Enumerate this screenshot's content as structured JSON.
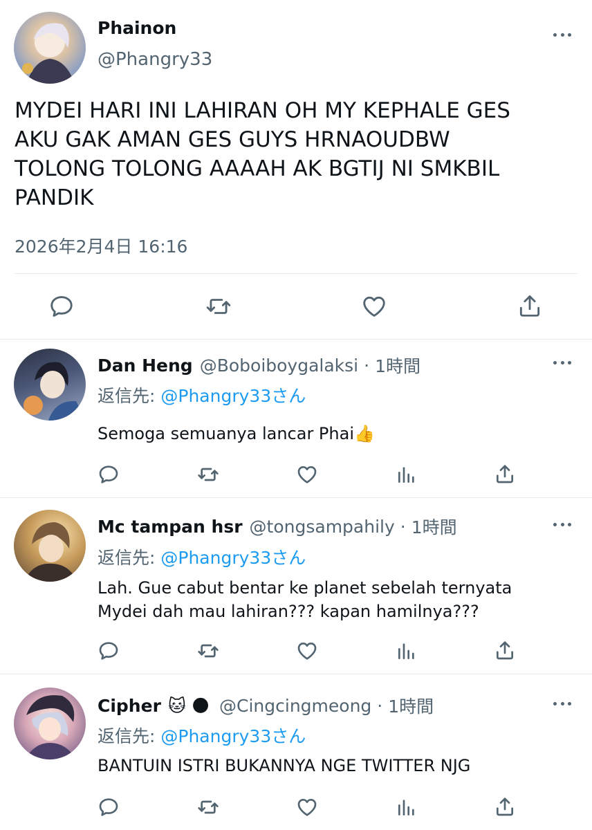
{
  "main_tweet": {
    "display_name": "Phainon",
    "handle": "@Phangry33",
    "text_lines": [
      "MYDEI HARI INI LAHIRAN OH MY KEPHALE GES",
      "AKU GAK AMAN GES GUYS HRNAOUDBW",
      "TOLONG TOLONG AAAAH AK BGTIJ NI SMKBIL",
      "PANDIK"
    ],
    "timestamp": "2026年2月4日 16:16",
    "actions": [
      "reply-icon",
      "retweet-icon",
      "like-icon",
      "share-icon"
    ]
  },
  "reply_prefix": "返信先:",
  "replies": [
    {
      "display_name": "Dan Heng",
      "handle": "@Boboiboygalaksi",
      "time": "1時間",
      "reply_to": "@Phangry33さん",
      "text_lines": [
        "Semoga semuanya lancar Phai"
      ],
      "emoji": "👍"
    },
    {
      "display_name": "Mc tampan hsr",
      "handle": "@tongsampahily",
      "time": "1時間",
      "reply_to": "@Phangry33さん",
      "text_lines": [
        "Lah. Gue cabut bentar ke planet sebelah ternyata",
        "Mydei dah mau lahiran??? kapan hamilnya???"
      ]
    },
    {
      "display_name": "Cipher",
      "name_emojis": [
        "🐱",
        "🌑"
      ],
      "handle": "@Cingcingmeong",
      "time": "1時間",
      "reply_to": "@Phangry33さん",
      "text_lines": [
        "BANTUIN ISTRI BUKANNYA NGE TWITTER NJG"
      ]
    }
  ],
  "separator": "·",
  "colors": {
    "link": "#1d9bf0",
    "secondary": "#536471",
    "text": "#0f1419",
    "divider": "#e6ecf0"
  }
}
